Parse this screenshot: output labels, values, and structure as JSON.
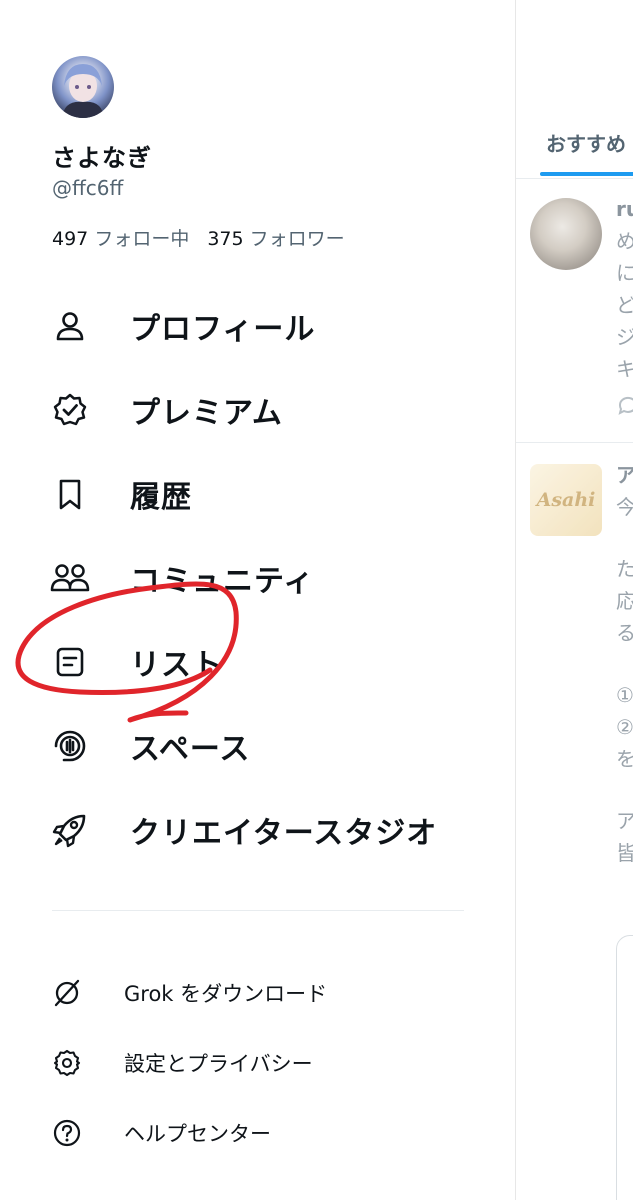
{
  "profile": {
    "display_name": "さよなぎ",
    "handle": "@ffc6ff",
    "following_count": "497",
    "following_label": "フォロー中",
    "followers_count": "375",
    "followers_label": "フォロワー"
  },
  "menu": [
    {
      "label": "プロフィール",
      "icon": "person-icon"
    },
    {
      "label": "プレミアム",
      "icon": "verified-badge-icon"
    },
    {
      "label": "履歴",
      "icon": "bookmark-icon"
    },
    {
      "label": "コミュニティ",
      "icon": "communities-icon"
    },
    {
      "label": "リスト",
      "icon": "lists-icon"
    },
    {
      "label": "スペース",
      "icon": "spaces-icon"
    },
    {
      "label": "クリエイタースタジオ",
      "icon": "rocket-icon"
    }
  ],
  "sub_menu": [
    {
      "label": "Grok をダウンロード",
      "icon": "grok-icon"
    },
    {
      "label": "設定とプライバシー",
      "icon": "gear-icon"
    },
    {
      "label": "ヘルプセンター",
      "icon": "help-icon"
    }
  ],
  "timeline": {
    "tab_label": "おすすめ",
    "post1": {
      "name": "ru",
      "lines": [
        "め",
        "に",
        "ど",
        "ジ",
        "キ"
      ]
    },
    "post2": {
      "avatar_text": "Asahi",
      "lines": [
        "ア",
        "今",
        "",
        "た",
        "応",
        "る",
        "",
        "①",
        "②",
        "を",
        "",
        "ア",
        "皆"
      ]
    }
  },
  "colors": {
    "accent": "#1d9bf0",
    "text": "#0f1419",
    "secondary": "#536471",
    "annotation": "#e0252b"
  }
}
